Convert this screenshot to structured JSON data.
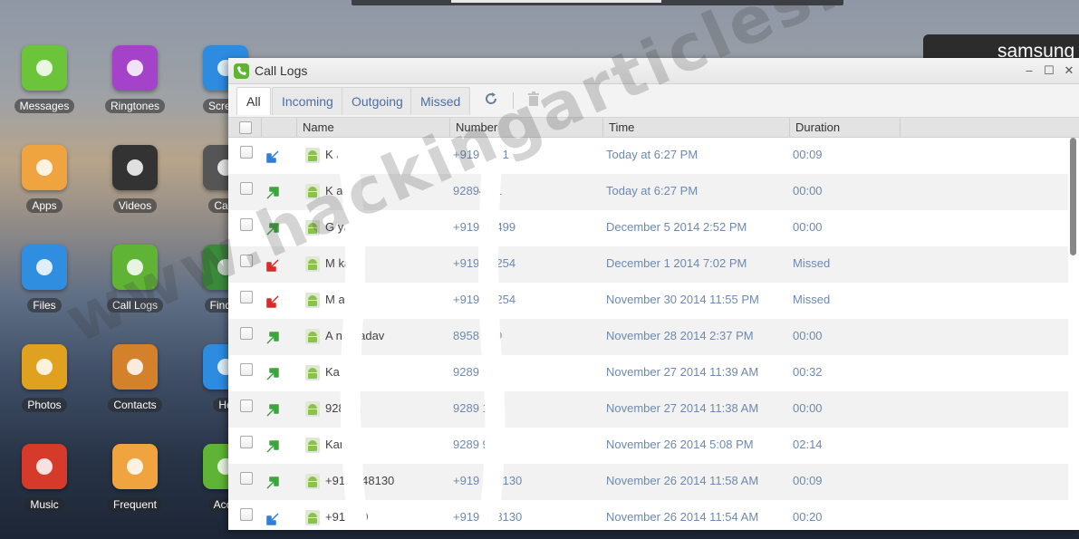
{
  "desktop": {
    "apps": [
      {
        "label": "Messages",
        "icon": "message-icon",
        "color": "#6cc43a"
      },
      {
        "label": "Ringtones",
        "icon": "speaker-icon",
        "color": "#a442c9"
      },
      {
        "label": "Screen",
        "icon": "crop-icon",
        "color": "#2d8be0"
      },
      {
        "label": "Apps",
        "icon": "app-box-icon",
        "color": "#f0a43f"
      },
      {
        "label": "Videos",
        "icon": "clapperboard-icon",
        "color": "#333333"
      },
      {
        "label": "Cam",
        "icon": "camera-icon",
        "color": "#555555"
      },
      {
        "label": "Files",
        "icon": "folder-icon",
        "color": "#2f8ee0"
      },
      {
        "label": "Call Logs",
        "icon": "phone-icon",
        "color": "#5fb436"
      },
      {
        "label": "Find P",
        "icon": "radar-icon",
        "color": "#3a8a3a"
      },
      {
        "label": "Photos",
        "icon": "photos-icon",
        "color": "#e0a020"
      },
      {
        "label": "Contacts",
        "icon": "contacts-icon",
        "color": "#d4812b"
      },
      {
        "label": "He",
        "icon": "help-icon",
        "color": "#2d8be0"
      },
      {
        "label": "Music",
        "icon": "music-icon",
        "color": "#d63a2a"
      },
      {
        "label": "Frequent",
        "icon": "frequent-icon",
        "color": "#f0a43f"
      },
      {
        "label": "Acco",
        "icon": "account-icon",
        "color": "#5fb436"
      }
    ],
    "device_name": "samsung",
    "watermark": "www.hackingarticles.in"
  },
  "window": {
    "title": "Call Logs",
    "controls": [
      "–",
      "☐",
      "✕"
    ],
    "tabs": [
      "All",
      "Incoming",
      "Outgoing",
      "Missed"
    ],
    "active_tab": "All",
    "toolbar": {
      "refresh_icon": "refresh-icon",
      "delete_icon": "trash-icon"
    },
    "columns": [
      "Name",
      "Number",
      "Time",
      "Duration"
    ],
    "rows": [
      {
        "direction": "incoming",
        "name": "K    a",
        "number": "+919      9971",
        "time": "Today at 6:27 PM",
        "duration": "00:09"
      },
      {
        "direction": "outgoing",
        "name": "K    a",
        "number": "928945    1",
        "time": "Today at 6:27 PM",
        "duration": "00:00"
      },
      {
        "direction": "outgoing",
        "name": "G    ya",
        "number": "+919     20499",
        "time": "December 5 2014 2:52 PM",
        "duration": "00:00"
      },
      {
        "direction": "missed",
        "name": "M     ka",
        "number": "+919     77254",
        "time": "December 1 2014 7:02 PM",
        "duration": "Missed"
      },
      {
        "direction": "missed",
        "name": "M     a",
        "number": "+919     77254",
        "time": "November 30 2014 11:55 PM",
        "duration": "Missed"
      },
      {
        "direction": "outgoing",
        "name": "A     na Yadav",
        "number": "8958     009",
        "time": "November 28 2014 2:37 PM",
        "duration": "00:00"
      },
      {
        "direction": "outgoing",
        "name": "Ka",
        "number": "9289     971",
        "time": "November 27 2014 11:39 AM",
        "duration": "00:32"
      },
      {
        "direction": "outgoing",
        "name": "928     71",
        "number": "9289     1",
        "time": "November 27 2014 11:38 AM",
        "duration": "00:00"
      },
      {
        "direction": "outgoing",
        "name": "Kam",
        "number": "9289     971",
        "time": "November 26 2014 5:08 PM",
        "duration": "02:14"
      },
      {
        "direction": "outgoing",
        "name": "+91     8048130",
        "number": "+919     048130",
        "time": "November 26 2014 11:58 AM",
        "duration": "00:09"
      },
      {
        "direction": "incoming",
        "name": "+91       130",
        "number": "+919     048130",
        "time": "November 26 2014 11:54 AM",
        "duration": "00:20"
      }
    ]
  },
  "colors": {
    "incoming": "#2f7fd6",
    "outgoing": "#3aa53a",
    "missed": "#d92b2b",
    "android": "#8bc34a"
  }
}
